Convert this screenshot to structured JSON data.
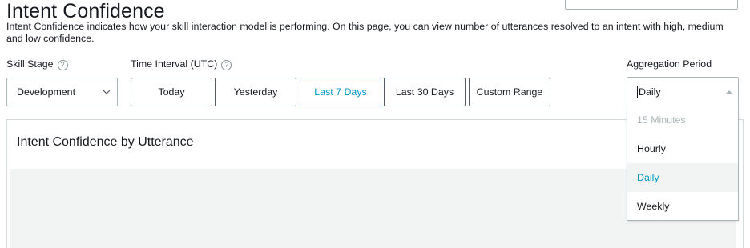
{
  "page": {
    "title": "Intent Confidence",
    "description": "Intent Confidence indicates how your skill interaction model is performing. On this page, you can view number of utterances resolved to an intent with high, medium and low confidence."
  },
  "controls": {
    "skill_stage": {
      "label": "Skill Stage",
      "value": "Development"
    },
    "time_interval": {
      "label": "Time Interval (UTC)",
      "options": [
        "Today",
        "Yesterday",
        "Last 7 Days",
        "Last 30 Days",
        "Custom Range"
      ],
      "selected": "Last 7 Days"
    },
    "aggregation_period": {
      "label": "Aggregation Period",
      "value": "Daily",
      "options": [
        "15 Minutes",
        "Hourly",
        "Daily",
        "Weekly"
      ],
      "disabled_option": "15 Minutes"
    }
  },
  "card": {
    "title": "Intent Confidence by Utterance"
  },
  "colors": {
    "accent": "#0096c7",
    "border": "#aab7b8",
    "chart_background": "#f2f4f3"
  }
}
